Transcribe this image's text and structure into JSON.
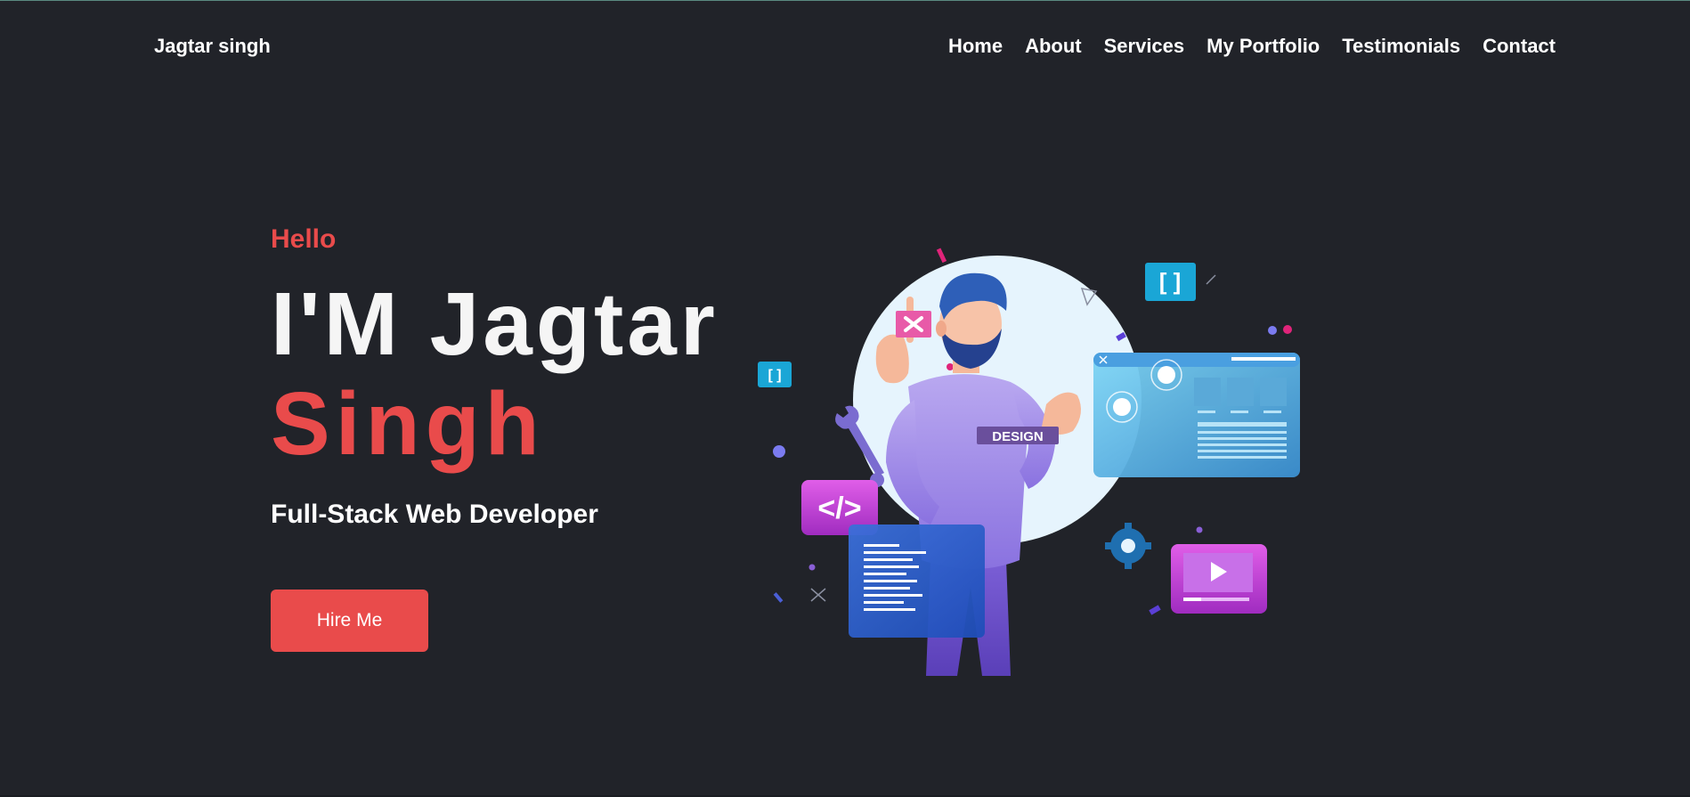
{
  "header": {
    "brand": "Jagtar singh",
    "nav": [
      {
        "label": "Home"
      },
      {
        "label": "About"
      },
      {
        "label": "Services"
      },
      {
        "label": "My Portfolio"
      },
      {
        "label": "Testimonials"
      },
      {
        "label": "Contact"
      }
    ]
  },
  "hero": {
    "greeting": "Hello",
    "name_line_1": "I'M Jagtar",
    "name_line_2": "Singh",
    "role": "Full-Stack Web Developer",
    "cta_label": "Hire Me",
    "illustration": {
      "shirt_text": "DESIGN",
      "code_badge": "</>",
      "bracket_badge": "[ ]"
    }
  },
  "colors": {
    "background": "#212329",
    "accent": "#e94b4b",
    "text": "#ffffff"
  }
}
